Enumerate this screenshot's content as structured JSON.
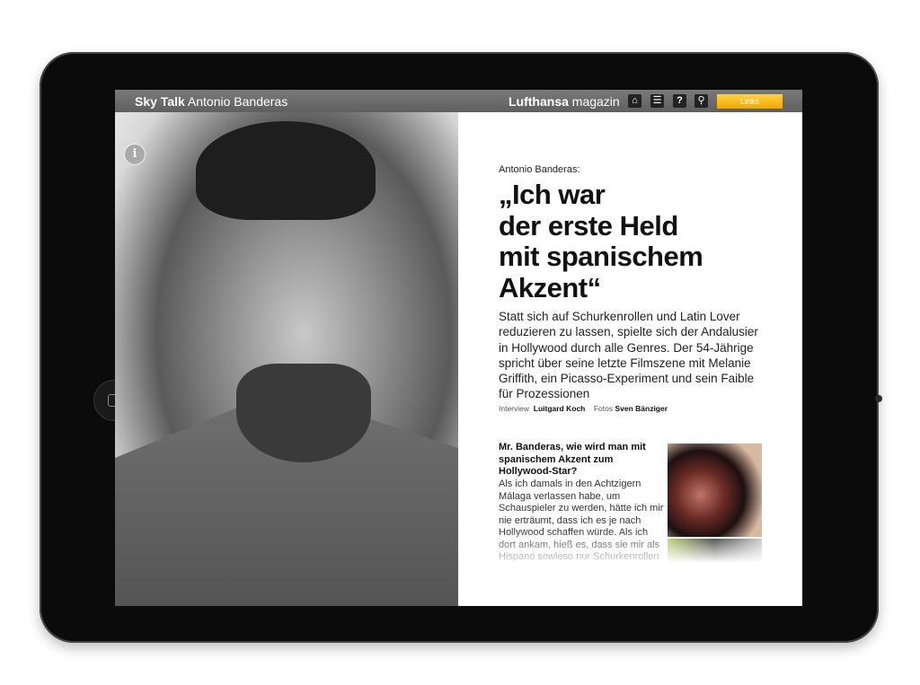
{
  "topbar": {
    "section_bold": "Sky Talk",
    "section_rest": "Antonio Banderas",
    "brand_bold": "Lufthansa",
    "brand_rest": "magazin",
    "links_label": "Links",
    "icons": [
      "home-icon",
      "list-icon",
      "help-icon",
      "search-icon"
    ]
  },
  "article": {
    "pre_title": "Antonio Banderas:",
    "headline": [
      "„Ich war",
      "der erste Held",
      "mit spanischem",
      "Akzent“"
    ],
    "lead": "Statt sich auf Schurkenrollen und Latin Lover reduzieren zu lassen, spielte sich der Andalusier in Hollywood durch alle Genres. Der 54-Jährige spricht über seine letzte Filmszene mit Melanie Griffith, ein Picasso-Experiment und sein Faible für Prozessionen",
    "credits": {
      "interview_label": "Interview",
      "interview_name": "Luitgard Koch",
      "photos_label": "Fotos",
      "photos_name": "Sven Bänziger"
    },
    "question": "Mr. Banderas, wie wird man mit spanischem Akzent zum Hollywood-Star?",
    "body": "Als ich damals in den Achtzigern Málaga verlassen habe, um Schauspieler zu werden, hätte ich mir nie erträumt, dass ich es je nach Hollywood schaffen würde. Als ich dort ankam, hieß es, dass sie mir als Hispano sowieso nur Schurkenrollen"
  },
  "info_label": "i"
}
